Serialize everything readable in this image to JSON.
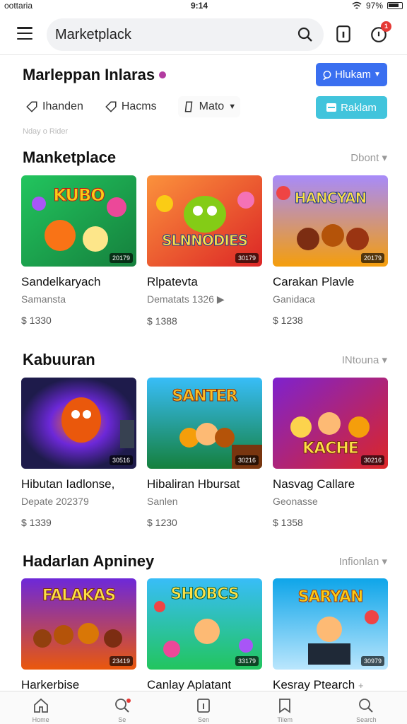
{
  "status": {
    "carrier": "oottaria",
    "time": "9:14",
    "battery": "97%"
  },
  "search": {
    "value": "Marketplack"
  },
  "notifications": {
    "count": "1"
  },
  "page": {
    "title": "Marleppan Inlaras",
    "primary_button": "Hlukam",
    "secondary_button": "Raklam",
    "subheading": "Nday o Rider"
  },
  "filters": [
    {
      "label": "Ihanden",
      "icon": "tag-icon"
    },
    {
      "label": "Hacms",
      "icon": "tag-icon"
    },
    {
      "label": "Mato",
      "icon": "sparkle-icon"
    }
  ],
  "sections": [
    {
      "title": "Manketplace",
      "more": "Dbont",
      "cards": [
        {
          "thumb_title": "KUBO",
          "tag": "20179",
          "name": "Sandelkaryach",
          "sub": "Samansta",
          "price": "$ 1330",
          "colors": [
            "#17a34a",
            "#f59e0b"
          ]
        },
        {
          "thumb_title": "SLNNODIES",
          "tag": "30179",
          "name": "Rlpatevta",
          "sub": "Dematats 1326 ▶",
          "price": "$ 1388",
          "colors": [
            "#f97316",
            "#dc2626"
          ]
        },
        {
          "thumb_title": "HANCYAN",
          "tag": "20179",
          "name": "Carakan Plavle",
          "sub": "Ganidaca",
          "price": "$ 1238",
          "colors": [
            "#7c3aed",
            "#f59e0b"
          ]
        }
      ]
    },
    {
      "title": "Kabuuran",
      "more": "INtouna",
      "cards": [
        {
          "thumb_title": "",
          "tag": "30516",
          "name": "Hibutan Iadlonse,",
          "sub": "Depate 202379",
          "price": "$ 1339",
          "colors": [
            "#4c1d95",
            "#0d9488"
          ]
        },
        {
          "thumb_title": "SANTER",
          "tag": "30216",
          "name": "Hibaliran Hbursat",
          "sub": "Sanlen",
          "price": "$ 1230",
          "colors": [
            "#38bdf8",
            "#16a34a"
          ]
        },
        {
          "thumb_title": "KACHE",
          "tag": "30216",
          "name": "Nasvag Callare",
          "sub": "Geonasse",
          "price": "$ 1358",
          "colors": [
            "#7c2d92",
            "#ef4444"
          ]
        }
      ]
    },
    {
      "title": "Hadarlan Apniney",
      "more": "Infionlan",
      "cards": [
        {
          "thumb_title": "FALAKAS",
          "tag": "23419",
          "name": "Harkerbise",
          "sub": "",
          "price": "",
          "colors": [
            "#6d28d9",
            "#f59e0b"
          ]
        },
        {
          "thumb_title": "SHOBCS",
          "tag": "33179",
          "name": "Canlay Aplatant",
          "sub": "",
          "price": "",
          "colors": [
            "#22c55e",
            "#0ea5e9"
          ]
        },
        {
          "thumb_title": "SARYAN",
          "tag": "30979",
          "name": "Kesray Ptearch",
          "sub": "",
          "price": "",
          "colors": [
            "#0ea5e9",
            "#f97316"
          ]
        }
      ]
    }
  ],
  "bottom_nav": [
    {
      "label": "Home",
      "icon": "home-icon"
    },
    {
      "label": "Se",
      "icon": "search-icon"
    },
    {
      "label": "Sen",
      "icon": "info-icon"
    },
    {
      "label": "Tilem",
      "icon": "bookmark-icon"
    },
    {
      "label": "Search",
      "icon": "search-icon"
    }
  ]
}
